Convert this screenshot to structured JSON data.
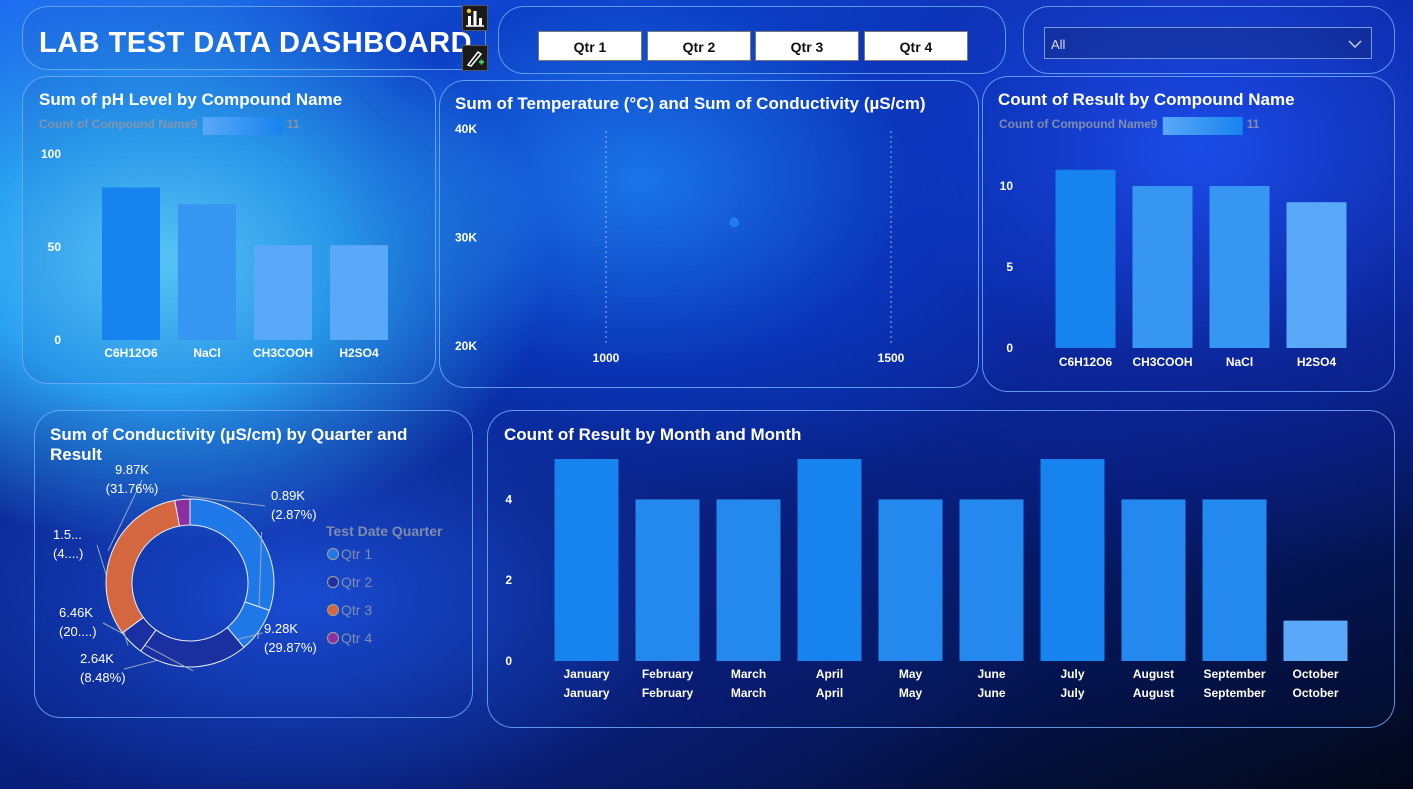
{
  "header": {
    "title": "LAB TEST DATA DASHBOARD"
  },
  "quarter_slicer": {
    "buttons": [
      "Qtr 1",
      "Qtr 2",
      "Qtr 3",
      "Qtr 4"
    ]
  },
  "filter_dropdown": {
    "value": "All"
  },
  "icons": {
    "bar-chart": "bar-chart-icon",
    "format-brush": "format-brush-icon",
    "dropdown": "chevron-down-icon"
  },
  "colors": {
    "bar_dark": "#1683ee",
    "bar_light": "#5aa8f8",
    "qtr1": "#1e78e8",
    "qtr2": "#1a2fa0",
    "qtr3": "#d4673f",
    "qtr4": "#8b2fa0"
  },
  "chart_data": [
    {
      "id": "ph",
      "type": "bar",
      "title": "Sum of pH Level by Compound Name",
      "legend": {
        "label": "Count of Compound Name",
        "min": "9",
        "max": "11"
      },
      "categories": [
        "C6H12O6",
        "NaCl",
        "CH3COOH",
        "H2SO4"
      ],
      "values": [
        82,
        73,
        51,
        51
      ],
      "color_values": [
        11,
        10,
        9,
        9
      ],
      "ylim": [
        0,
        100
      ],
      "yticks": [
        "0",
        "50",
        "100"
      ]
    },
    {
      "id": "scatter",
      "type": "scatter",
      "title": "Sum of Temperature (°C) and Sum of Conductivity (µS/cm)",
      "points": [
        {
          "x": 1225,
          "y": 31300
        }
      ],
      "xlim": [
        1000,
        1500
      ],
      "ylim": [
        20000,
        40000
      ],
      "xticks": [
        "1000",
        "1500"
      ],
      "yticks": [
        "20K",
        "30K",
        "40K"
      ]
    },
    {
      "id": "result",
      "type": "bar",
      "title": "Count of Result by Compound Name",
      "legend": {
        "label": "Count of Compound Name",
        "min": "9",
        "max": "11"
      },
      "categories": [
        "C6H12O6",
        "CH3COOH",
        "NaCl",
        "H2SO4"
      ],
      "values": [
        11,
        10,
        10,
        9
      ],
      "color_values": [
        11,
        10,
        10,
        9
      ],
      "ylim": [
        0,
        10
      ],
      "yticks": [
        "0",
        "5",
        "10"
      ]
    },
    {
      "id": "donut",
      "type": "pie",
      "title": "Sum of Conductivity (µS/cm) by Quarter and Result",
      "legend_title": "Test Date Quarter",
      "legend": [
        "Qtr 1",
        "Qtr 2",
        "Qtr 3",
        "Qtr 4"
      ],
      "slices": [
        {
          "quarter": "Qtr 1",
          "value": 9.28,
          "label": "9.28K (29.87%)"
        },
        {
          "quarter": "Qtr 1",
          "value": 2.64,
          "label": "2.64K (8.48%)"
        },
        {
          "quarter": "Qtr 2",
          "value": 6.46,
          "label": "6.46K (20....)"
        },
        {
          "quarter": "Qtr 2",
          "value": 1.5,
          "label": "1.5... (4....)"
        },
        {
          "quarter": "Qtr 3",
          "value": 9.87,
          "label": "9.87K (31.76%)"
        },
        {
          "quarter": "Qtr 4",
          "value": 0.89,
          "label": "0.89K (2.87%)"
        }
      ]
    },
    {
      "id": "month",
      "type": "bar",
      "title": "Count of Result by Month and Month",
      "categories": [
        "January",
        "February",
        "March",
        "April",
        "May",
        "June",
        "July",
        "August",
        "September",
        "October"
      ],
      "category_lines": [
        [
          "January",
          "January"
        ],
        [
          "February",
          "February"
        ],
        [
          "March",
          "March"
        ],
        [
          "April",
          "April"
        ],
        [
          "May",
          "May"
        ],
        [
          "June",
          "June"
        ],
        [
          "July",
          "July"
        ],
        [
          "August",
          "August"
        ],
        [
          "September",
          "September"
        ],
        [
          "October",
          "October"
        ]
      ],
      "values": [
        5,
        4,
        4,
        5,
        4,
        4,
        5,
        4,
        4,
        1
      ],
      "ylim": [
        0,
        5
      ],
      "yticks": [
        "0",
        "2",
        "4"
      ]
    }
  ]
}
